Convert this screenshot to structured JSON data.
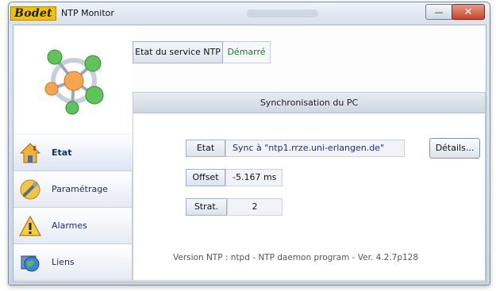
{
  "window": {
    "logo_text": "Bodet",
    "title": "NTP Monitor",
    "minimize_symbol": "—",
    "close_symbol": "✕"
  },
  "service": {
    "label": "Etat du service NTP",
    "value": "Démarré"
  },
  "sync": {
    "header": "Synchronisation du PC",
    "etat_label": "Etat",
    "etat_value": "Sync à \"ntp1.rrze.uni-erlangen.de\"",
    "details_label": "Détails...",
    "offset_label": "Offset",
    "offset_value": "-5.167 ms",
    "strat_label": "Strat.",
    "strat_value": "2",
    "version_text": "Version NTP :  ntpd - NTP daemon program - Ver. 4.2.7p128"
  },
  "nav": {
    "items": [
      {
        "label": "Etat",
        "icon": "house-icon",
        "active": true
      },
      {
        "label": "Paramétrage",
        "icon": "wrench-icon",
        "active": false
      },
      {
        "label": "Alarmes",
        "icon": "warning-icon",
        "active": false
      },
      {
        "label": "Liens",
        "icon": "globe-icon",
        "active": false
      }
    ]
  },
  "colors": {
    "logo_yellow": "#f2c200",
    "status_green": "#1a7a1a",
    "link_blue": "#1d2e8a",
    "nav_text": "#1b2e5a"
  }
}
